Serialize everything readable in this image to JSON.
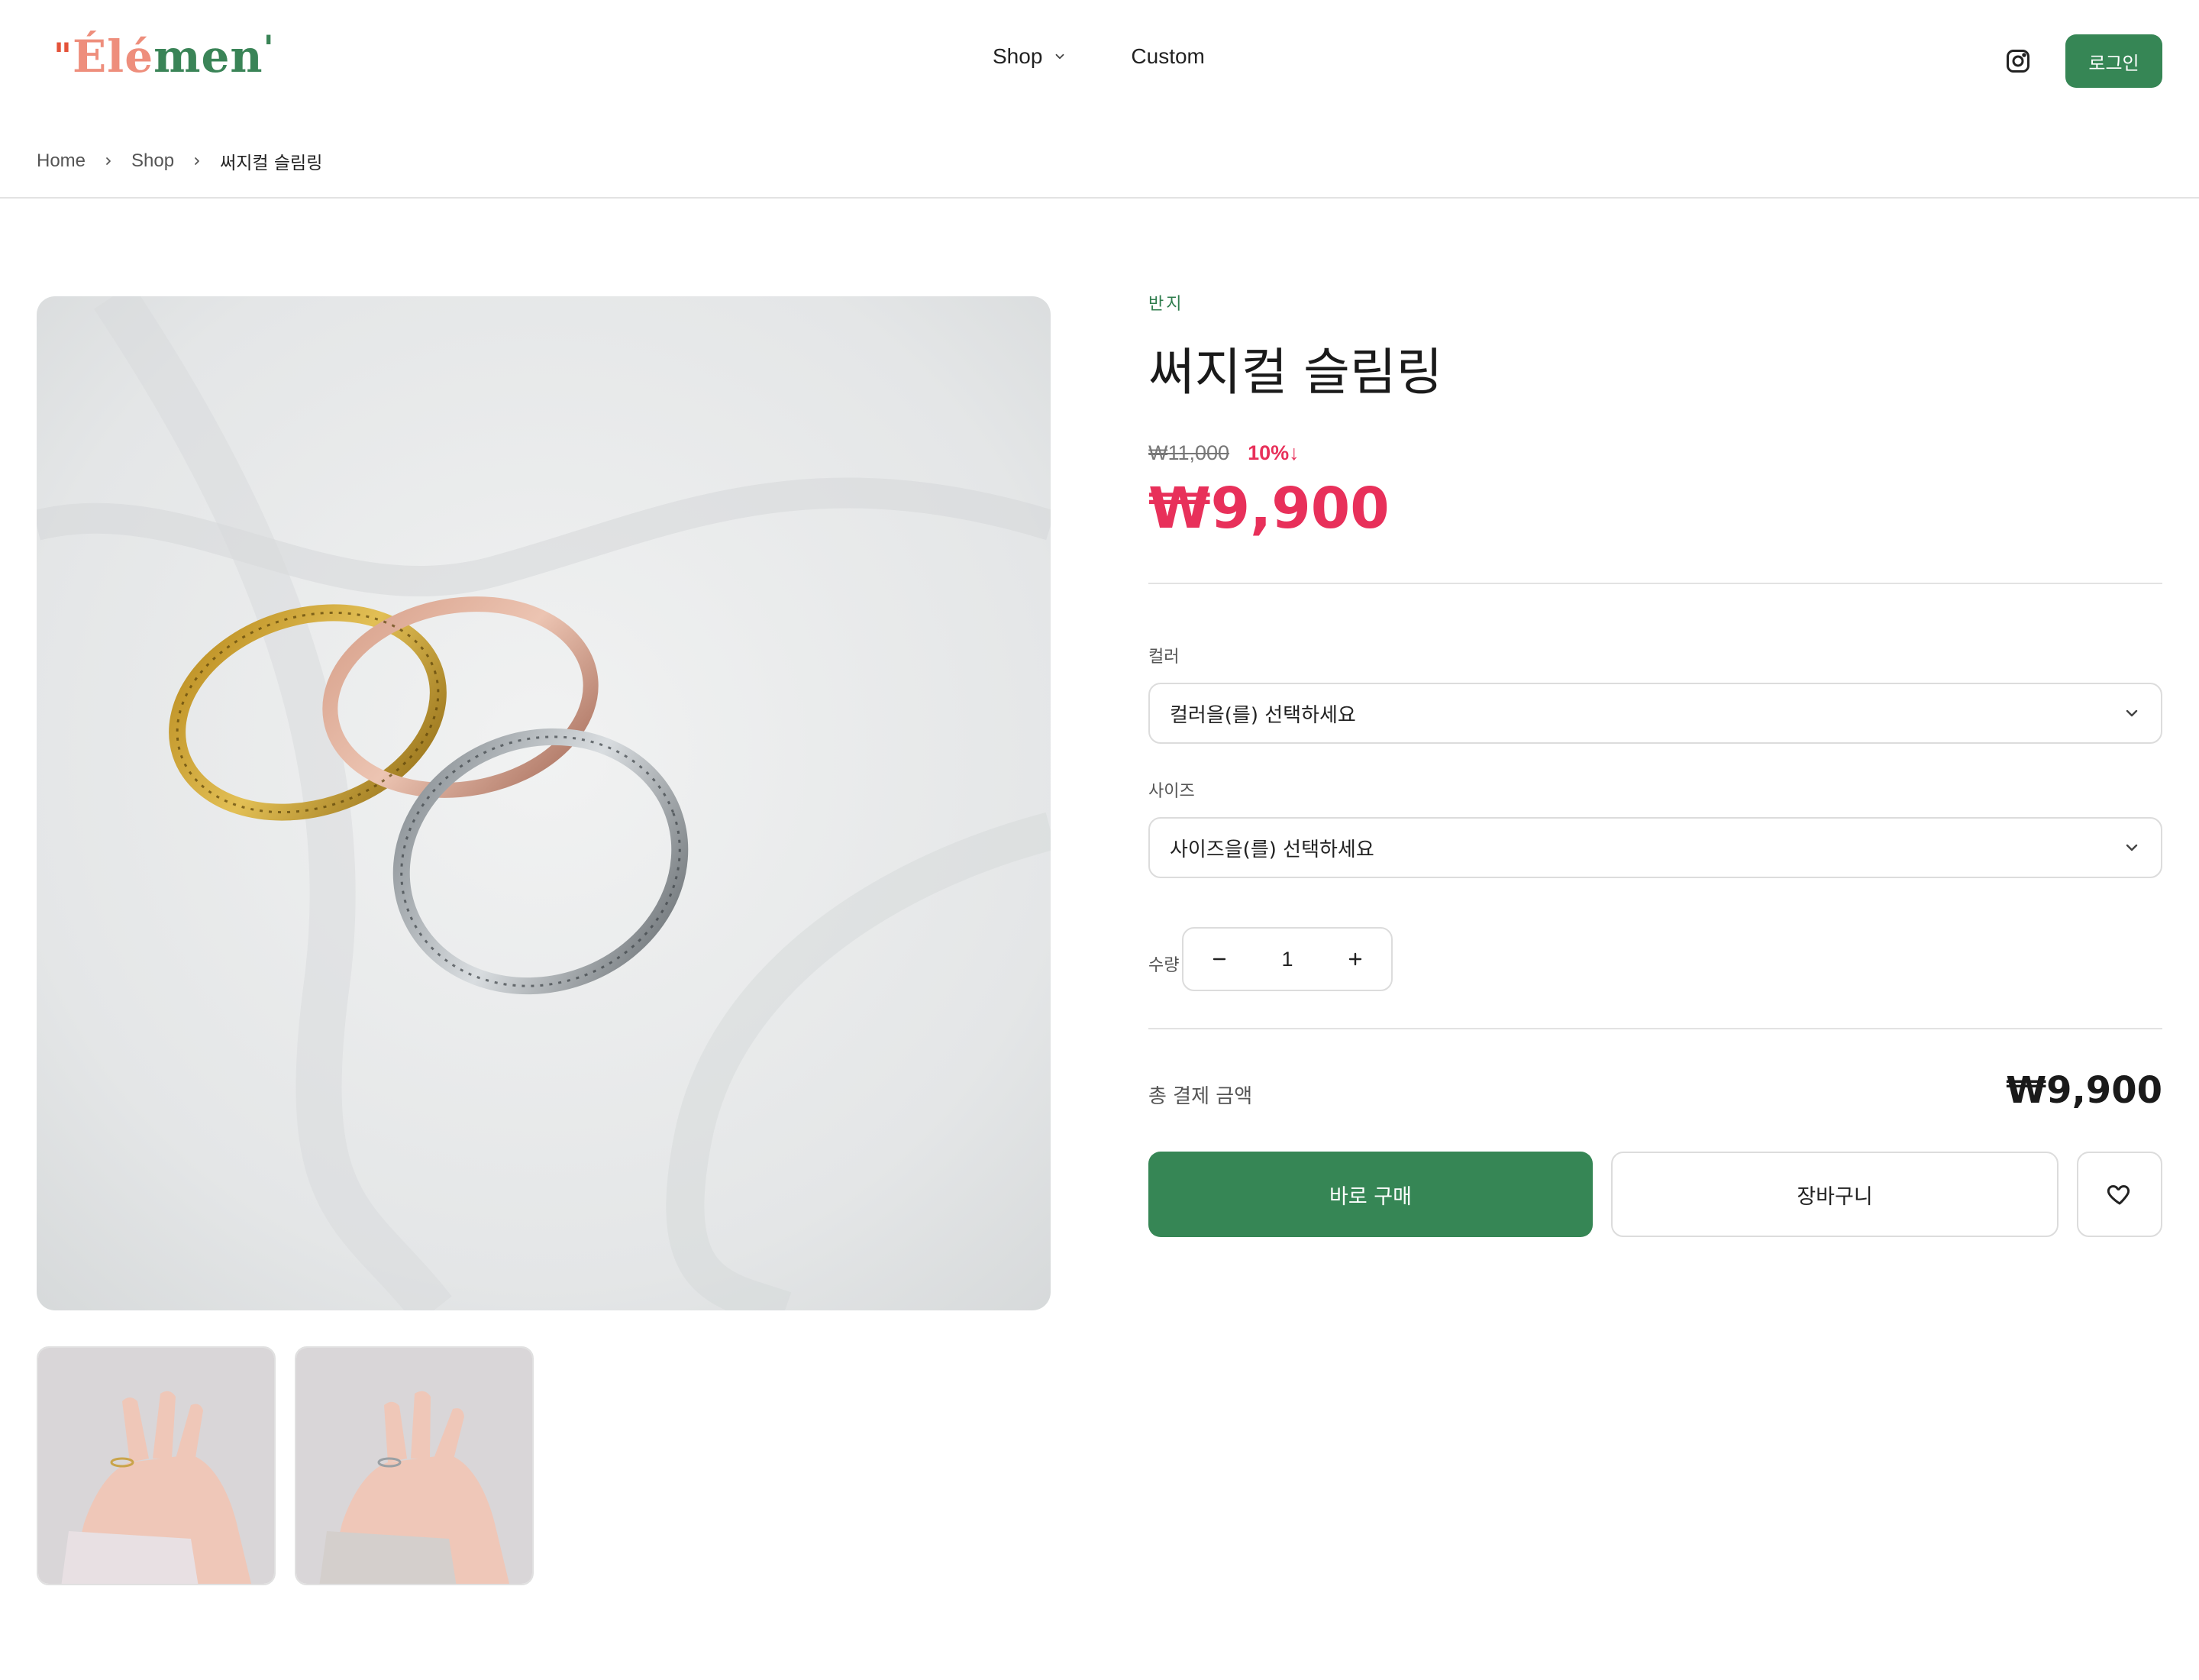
{
  "brand": {
    "logo_text": "\"Élémen'",
    "quote_open": "\"",
    "letters_pink": "Élé",
    "letters_green": "men",
    "quote_close": "'"
  },
  "nav": {
    "items": [
      {
        "label": "Shop",
        "icon": "chevron-down-icon"
      },
      {
        "label": "Custom"
      }
    ]
  },
  "header": {
    "instagram_icon": "instagram-icon",
    "login_label": "로그인"
  },
  "breadcrumb": {
    "items": [
      "Home",
      "Shop",
      "써지컬 슬림링"
    ]
  },
  "product": {
    "category": "반지",
    "title": "써지컬 슬림링",
    "original_price": "₩11,000",
    "discount": "10%↓",
    "sale_price": "₩9,900",
    "main_image": "rings-photo",
    "thumbnails": [
      "hand-ring-photo-1",
      "hand-ring-photo-2"
    ]
  },
  "options": {
    "color": {
      "label": "컬러",
      "placeholder": "컬러을(를) 선택하세요"
    },
    "size": {
      "label": "사이즈",
      "placeholder": "사이즈을(를) 선택하세요"
    }
  },
  "quantity": {
    "label": "수량",
    "value": "1"
  },
  "total": {
    "label": "총 결제 금액",
    "value": "₩9,900"
  },
  "actions": {
    "buy_label": "바로 구매",
    "cart_label": "장바구니",
    "wish_icon": "heart-icon"
  },
  "colors": {
    "accent_green": "#368655",
    "sale_red": "#e8305a",
    "logo_pink": "#ee8e7c",
    "logo_red": "#e4533a"
  }
}
